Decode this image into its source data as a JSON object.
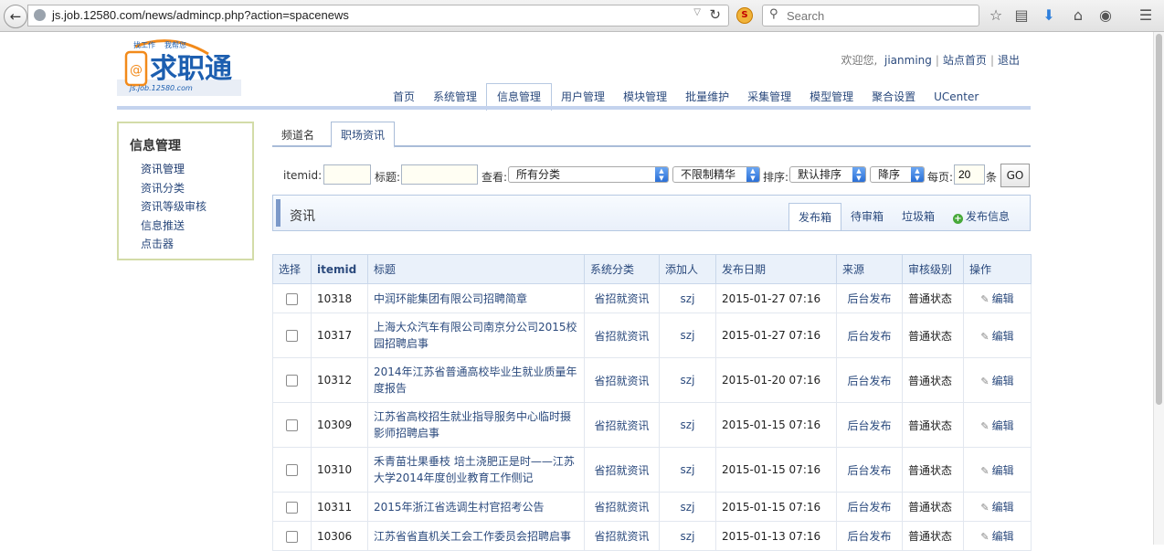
{
  "browser": {
    "url": "js.job.12580.com/news/admincp.php?action=spacenews",
    "search_placeholder": "Search"
  },
  "header": {
    "welcome_prefix": "欢迎您,",
    "username": "jianming",
    "site_home": "站点首页",
    "logout": "退出"
  },
  "logo": {
    "tag1": "找工作",
    "tag2": "我帮您",
    "name": "求职通",
    "domain": "js.job.12580.com"
  },
  "nav": {
    "items": [
      "首页",
      "系统管理",
      "信息管理",
      "用户管理",
      "模块管理",
      "批量维护",
      "采集管理",
      "模型管理",
      "聚合设置",
      "UCenter"
    ],
    "active_index": 2
  },
  "sidebar": {
    "title": "信息管理",
    "items": [
      "资讯管理",
      "资讯分类",
      "资讯等级审核",
      "信息推送",
      "点击器"
    ]
  },
  "channel": {
    "label": "频道名",
    "tab": "职场资讯"
  },
  "filters": {
    "itemid_label": "itemid:",
    "title_label": "标题:",
    "view_label": "查看:",
    "category": "所有分类",
    "elite": "不限制精华",
    "sort_label": "排序:",
    "sort": "默认排序",
    "order": "降序",
    "perpage_label": "每页:",
    "perpage": "20",
    "unit": "条",
    "go": "GO"
  },
  "panel": {
    "title": "资讯",
    "tabs": [
      "发布箱",
      "待审箱",
      "垃圾箱"
    ],
    "publish": "发布信息"
  },
  "table": {
    "headers": [
      "选择",
      "itemid",
      "标题",
      "系统分类",
      "添加人",
      "发布日期",
      "来源",
      "审核级别",
      "操作"
    ],
    "edit_label": "编辑",
    "rows": [
      {
        "id": "10318",
        "title": "中润环能集团有限公司招聘简章",
        "cat": "省招就资讯",
        "user": "szj",
        "date": "2015-01-27 07:16",
        "source": "后台发布",
        "level": "普通状态"
      },
      {
        "id": "10317",
        "title": "上海大众汽车有限公司南京分公司2015校园招聘启事",
        "cat": "省招就资讯",
        "user": "szj",
        "date": "2015-01-27 07:16",
        "source": "后台发布",
        "level": "普通状态"
      },
      {
        "id": "10312",
        "title": "2014年江苏省普通高校毕业生就业质量年度报告",
        "cat": "省招就资讯",
        "user": "szj",
        "date": "2015-01-20 07:16",
        "source": "后台发布",
        "level": "普通状态"
      },
      {
        "id": "10309",
        "title": "江苏省高校招生就业指导服务中心临时摄影师招聘启事",
        "cat": "省招就资讯",
        "user": "szj",
        "date": "2015-01-15 07:16",
        "source": "后台发布",
        "level": "普通状态"
      },
      {
        "id": "10310",
        "title": "禾青苗壮果垂枝 培土浇肥正是时——江苏大学2014年度创业教育工作侧记",
        "cat": "省招就资讯",
        "user": "szj",
        "date": "2015-01-15 07:16",
        "source": "后台发布",
        "level": "普通状态"
      },
      {
        "id": "10311",
        "title": "2015年浙江省选调生村官招考公告",
        "cat": "省招就资讯",
        "user": "szj",
        "date": "2015-01-15 07:16",
        "source": "后台发布",
        "level": "普通状态"
      },
      {
        "id": "10306",
        "title": "江苏省省直机关工会工作委员会招聘启事",
        "cat": "省招就资讯",
        "user": "szj",
        "date": "2015-01-13 07:16",
        "source": "后台发布",
        "level": "普通状态"
      }
    ]
  }
}
